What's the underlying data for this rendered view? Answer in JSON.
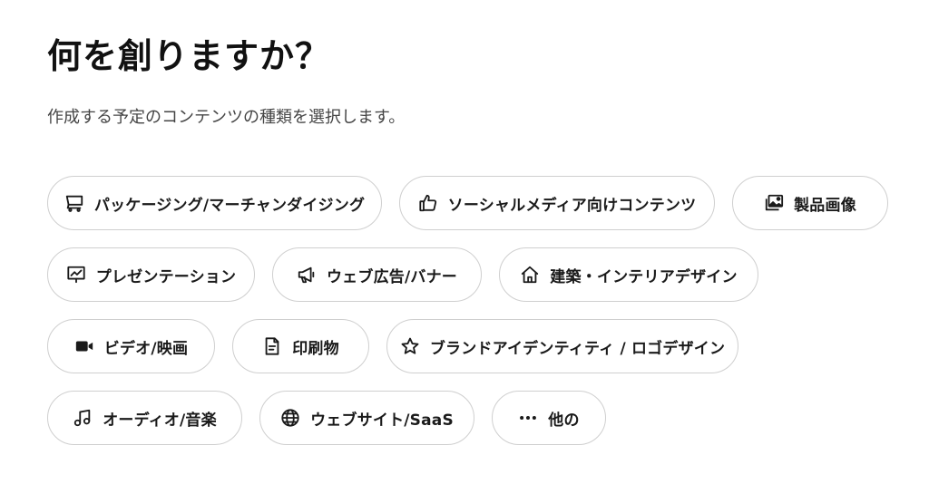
{
  "page": {
    "title": "何を創りますか？",
    "subtitle": "作成する予定のコンテンツの種類を選択します。"
  },
  "options": [
    {
      "label": "パッケージング/マーチャンダイジング",
      "icon": "cart-icon"
    },
    {
      "label": "ソーシャルメディア向けコンテンツ",
      "icon": "thumbs-up-icon"
    },
    {
      "label": "製品画像",
      "icon": "images-icon"
    },
    {
      "label": "プレゼンテーション",
      "icon": "presentation-chart-icon"
    },
    {
      "label": "ウェブ広告/バナー",
      "icon": "megaphone-icon"
    },
    {
      "label": "建築・インテリアデザイン",
      "icon": "home-icon"
    },
    {
      "label": "ビデオ/映画",
      "icon": "video-camera-icon"
    },
    {
      "label": "印刷物",
      "icon": "document-icon"
    },
    {
      "label": "ブランドアイデンティティ / ロゴデザイン",
      "icon": "star-icon"
    },
    {
      "label": "オーディオ/音楽",
      "icon": "music-note-icon"
    },
    {
      "label": "ウェブサイト/SaaS",
      "icon": "globe-icon"
    },
    {
      "label": "他の",
      "icon": "more-dots-icon"
    }
  ]
}
